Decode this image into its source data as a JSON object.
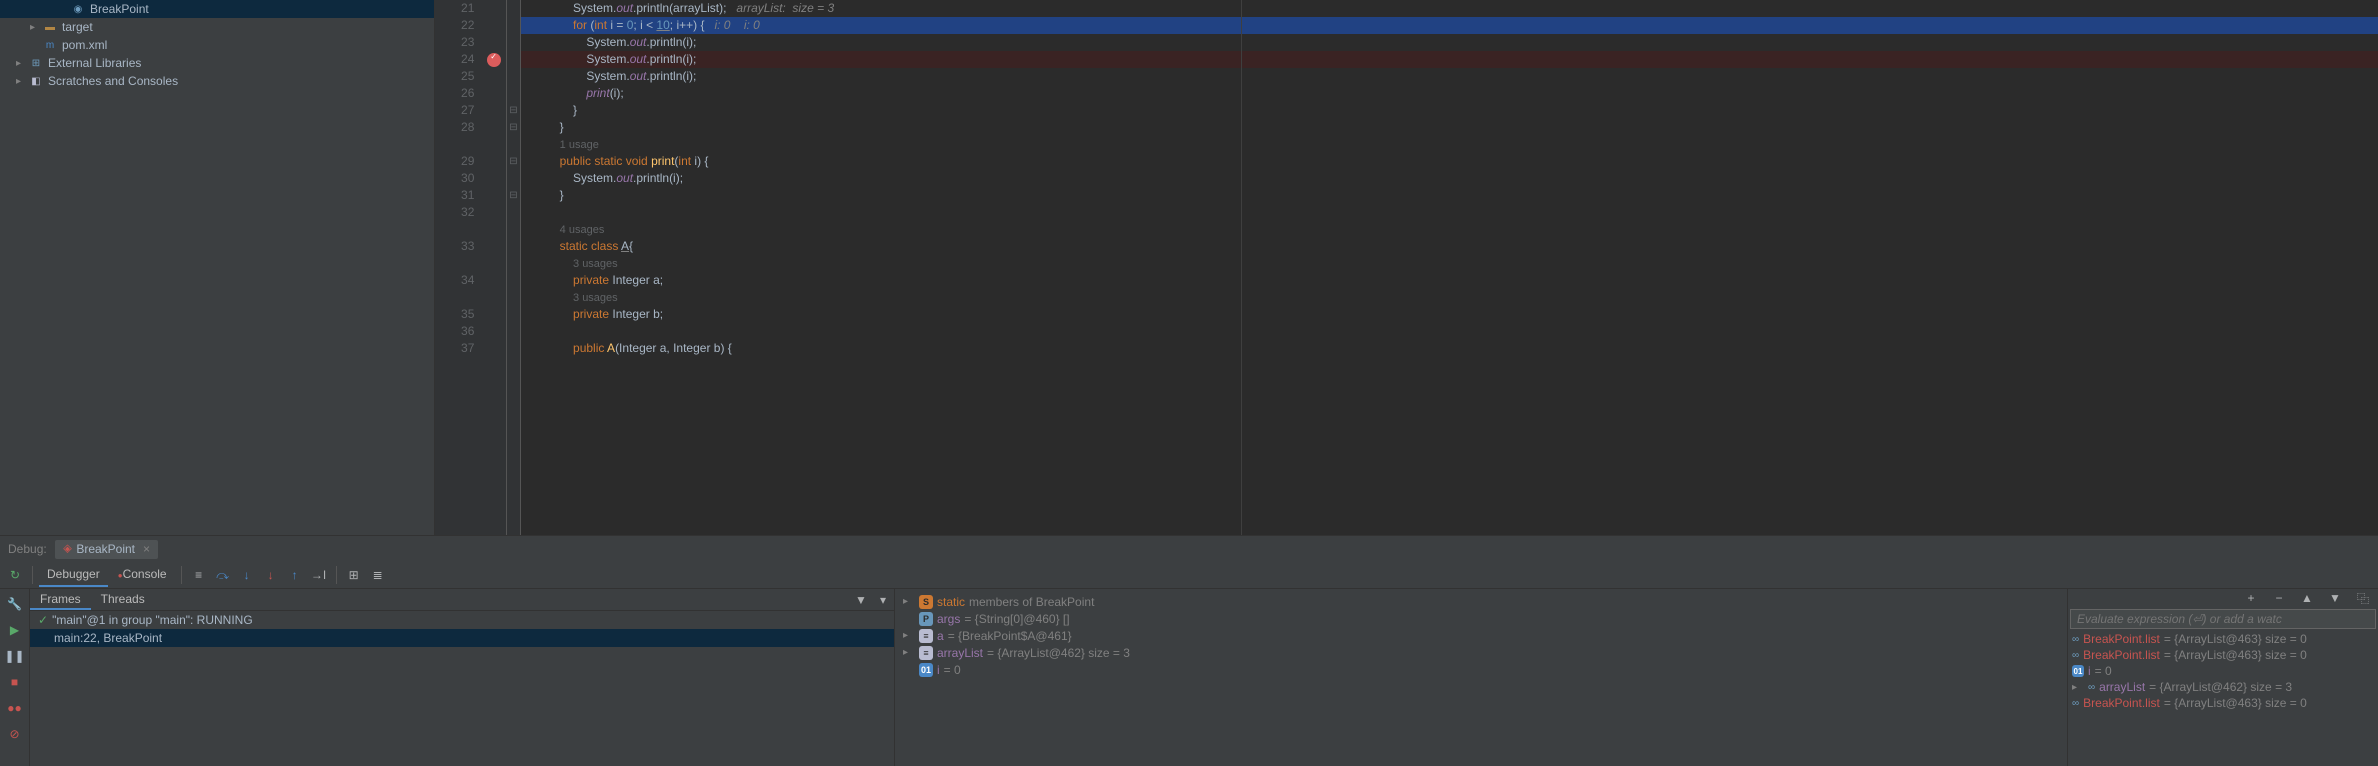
{
  "tree": {
    "breakpoint": "BreakPoint",
    "target": "target",
    "pom": "pom.xml",
    "external": "External Libraries",
    "scratches": "Scratches and Consoles"
  },
  "lines": {
    "l21": "21",
    "l22": "22",
    "l23": "23",
    "l24": "24",
    "l25": "25",
    "l26": "26",
    "l27": "27",
    "l28": "28",
    "l29": "29",
    "l30": "30",
    "l31": "31",
    "l32": "32",
    "l33": "33",
    "l34": "34",
    "l35": "35",
    "l36": "36",
    "l37": "37"
  },
  "code": {
    "c21a": "System.",
    "c21b": "out",
    "c21c": ".println(arrayList);",
    "c21hint": "   arrayList:  size = 3",
    "c22a": "for ",
    "c22b": "(",
    "c22c": "int ",
    "c22d": "i = ",
    "c22e": "0",
    "c22f": "; i < ",
    "c22g": "10",
    "c22h": "; i++) {",
    "c22hint": "   i: 0    i: 0",
    "c23a": "System.",
    "c23b": "out",
    "c23c": ".println(i);",
    "c24a": "System.",
    "c24b": "out",
    "c24c": ".println(i);",
    "c25a": "System.",
    "c25b": "out",
    "c25c": ".println(i);",
    "c26a": "print",
    "c26b": "(i);",
    "c27": "}",
    "c28": "}",
    "usage1": "1 usage",
    "c29a": "public static void ",
    "c29b": "print",
    "c29c": "(",
    "c29d": "int ",
    "c29e": "i) {",
    "c30a": "System.",
    "c30b": "out",
    "c30c": ".println(i);",
    "c31": "}",
    "usage4": "4 usages",
    "c33a": "static class ",
    "c33b": "A",
    "c33c": "{",
    "usage3a": "3 usages",
    "c34a": "private ",
    "c34b": "Integer ",
    "c34c": "a;",
    "usage3b": "3 usages",
    "c35a": "private ",
    "c35b": "Integer ",
    "c35c": "b;",
    "c37a": "public ",
    "c37b": "A",
    "c37c": "(Integer a, Integer b) {"
  },
  "debug": {
    "label": "Debug:",
    "config": "BreakPoint",
    "tab_debugger": "Debugger",
    "tab_console": "Console",
    "tab_frames": "Frames",
    "tab_threads": "Threads",
    "thread": "\"main\"@1 in group \"main\": RUNNING",
    "frame": "main:22, BreakPoint"
  },
  "vars": {
    "v1a": "static",
    "v1b": " members of BreakPoint",
    "v2a": "args",
    "v2b": " = {String[0]@460} []",
    "v3a": "a",
    "v3b": " = {BreakPoint$A@461}",
    "v4a": "arrayList",
    "v4b": " = {ArrayList@462}  size = 3",
    "v5a": "i",
    "v5b": " = 0"
  },
  "watches": {
    "placeholder": "Evaluate expression (⏎) or add a watc",
    "w1a": "BreakPoint.list",
    "w1b": " = {ArrayList@463}  size = 0",
    "w2a": "BreakPoint.list",
    "w2b": " = {ArrayList@463}  size = 0",
    "w3a": "i",
    "w3b": " = 0",
    "w4a": "arrayList",
    "w4b": " = {ArrayList@462}  size = 3",
    "w5a": "BreakPoint.list",
    "w5b": " = {ArrayList@463}  size = 0"
  }
}
